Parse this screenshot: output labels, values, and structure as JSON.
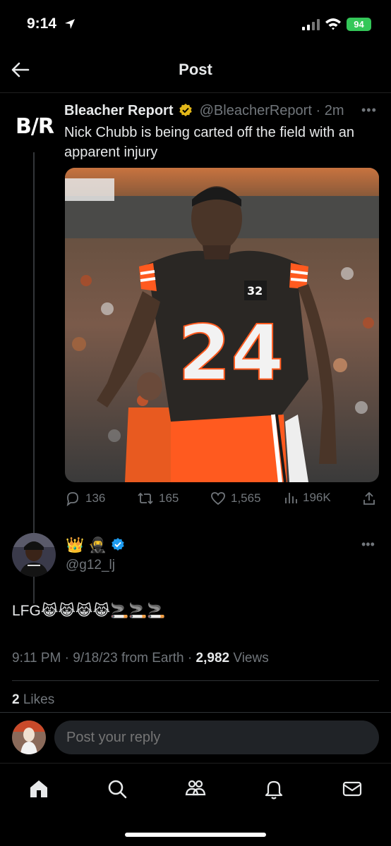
{
  "status_bar": {
    "time": "9:14",
    "battery": "94"
  },
  "header": {
    "title": "Post"
  },
  "parent_tweet": {
    "logo_text": "B/R",
    "author_name": "Bleacher Report",
    "handle": "@BleacherReport",
    "separator": "·",
    "time_ago": "2m",
    "text": "Nick Chubb is being carted off the field with an apparent injury",
    "photo_jersey_number": "24",
    "photo_sleeve_number": "32",
    "metrics": {
      "replies": "136",
      "reposts": "165",
      "likes": "1,565",
      "views": "196K"
    }
  },
  "reply_tweet": {
    "name_emoji": "👑 🥷",
    "handle": "@g12_lj",
    "text": "LFG😹😹😹😹🚬🚬🚬",
    "time": "9:11 PM",
    "date": "9/18/23",
    "source": "from Earth",
    "sep": "·",
    "views_count": "2,982",
    "views_label": "Views",
    "likes_count": "2",
    "likes_label": "Likes"
  },
  "reply_bar": {
    "placeholder": "Post your reply"
  },
  "colors": {
    "background": "#000000",
    "text_primary": "#e7e9ea",
    "text_secondary": "#71767b",
    "verified_gold": "#e2b719",
    "verified_blue": "#1d9bf0",
    "battery_green": "#34c759",
    "browns_orange": "#ff5a1f"
  },
  "icons": [
    "location-arrow-icon",
    "signal-icon",
    "wifi-icon",
    "back-arrow-icon",
    "verified-gold-icon",
    "more-icon",
    "reply-icon",
    "repost-icon",
    "like-icon",
    "views-icon",
    "share-icon",
    "verified-blue-icon",
    "home-icon",
    "search-icon",
    "communities-icon",
    "notifications-icon",
    "messages-icon"
  ]
}
